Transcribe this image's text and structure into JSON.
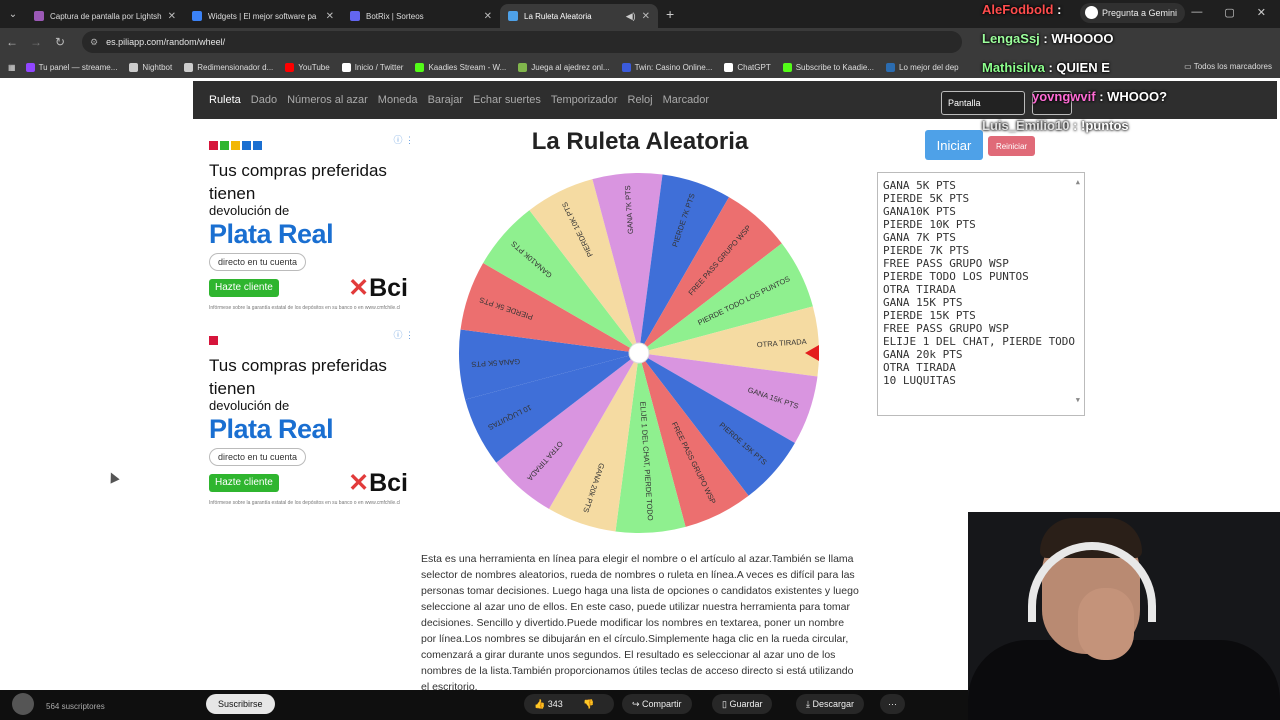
{
  "browser": {
    "tabs": [
      {
        "title": "Captura de pantalla por Lightsh",
        "color": "#9b59b6",
        "active": false
      },
      {
        "title": "Widgets | El mejor software pa",
        "color": "#3b82f6",
        "active": false
      },
      {
        "title": "BotRix | Sorteos",
        "color": "#6366f1",
        "active": false
      },
      {
        "title": "La Ruleta Aleatoria",
        "color": "#4ea1e8",
        "active": true
      }
    ],
    "url": "es.piliapp.com/random/wheel/",
    "bookmarks": [
      {
        "label": "Tu panel — streame...",
        "color": "#9146ff"
      },
      {
        "label": "Nightbot",
        "color": "#cccccc"
      },
      {
        "label": "Redimensionador d...",
        "color": "#cccccc"
      },
      {
        "label": "YouTube",
        "color": "#ff0000"
      },
      {
        "label": "Inicio / Twitter",
        "color": "#ffffff"
      },
      {
        "label": "Kaadies Stream - W...",
        "color": "#53fc18"
      },
      {
        "label": "Juega al ajedrez onl...",
        "color": "#81b64c"
      },
      {
        "label": "Twin: Casino Online...",
        "color": "#3b5bdb"
      },
      {
        "label": "ChatGPT",
        "color": "#ffffff"
      },
      {
        "label": "Subscribe to Kaadie...",
        "color": "#53fc18"
      },
      {
        "label": "Lo mejor del dep",
        "color": "#2b6cb0"
      }
    ],
    "bookmarks_right": "Todos los marcadores"
  },
  "site": {
    "nav": [
      "Ruleta",
      "Dado",
      "Números al azar",
      "Moneda",
      "Barajar",
      "Echar suertes",
      "Temporizador",
      "Reloj",
      "Marcador"
    ],
    "active_nav": "Ruleta",
    "fullscreen_label": "Pantalla",
    "title": "La Ruleta Aleatoria",
    "start_label": "Iniciar",
    "reset_label": "Reiniciar",
    "entries": [
      "GANA 5K PTS",
      "PIERDE 5K PTS",
      "GANA10K PTS",
      "PIERDE 10K PTS",
      "GANA 7K PTS",
      "PIERDE 7K PTS",
      "FREE PASS GRUPO WSP",
      "PIERDE TODO LOS PUNTOS",
      "OTRA TIRADA",
      "GANA 15K PTS",
      "PIERDE 15K PTS",
      "FREE PASS GRUPO WSP",
      "ELIJE 1 DEL CHAT, PIERDE TODO",
      "GANA 20k PTS",
      "OTRA TIRADA",
      "10 LUQUITAS"
    ],
    "description": "Esta es una herramienta en línea para elegir el nombre o el artículo al azar.También se llama selector de nombres aleatorios, rueda de nombres o ruleta en línea.A veces es difícil para las personas tomar decisiones. Luego haga una lista de opciones o candidatos existentes y luego seleccione al azar uno de ellos. En este caso, puede utilizar nuestra herramienta para tomar decisiones. Sencillo y divertido.Puede modificar los nombres en textarea, poner un nombre por línea.Los nombres se dibujarán en el círculo.Simplemente haga clic en la rueda circular, comenzará a girar durante unos segundos. El resultado es seleccionar al azar uno de los nombres de la lista.También proporcionamos útiles teclas de acceso directo si está utilizando el escritorio."
  },
  "wheel": {
    "labels": [
      "GANA 5K PTS",
      "PIERDE 5K PTS",
      "GANA10K PTS",
      "PIERDE 10K PTS",
      "GANA 7K PTS",
      "PIERDE 7K PTS",
      "FREE PASS GRUPO WSP",
      "PIERDE TODO LOS PUNTOS",
      "OTRA TIRADA",
      "GANA 15K PTS",
      "PIERDE 15K PTS",
      "FREE PASS GRUPO WSP",
      "ELIJE 1 DEL CHAT, PIERDE TODO",
      "GANA 20k PTS",
      "OTRA TIRADA",
      "10 LUQUITAS"
    ],
    "colors": [
      "#3f6fd8",
      "#ec6f6f",
      "#8ff08f",
      "#f5dba2",
      "#d995e0"
    ],
    "pointer_color": "#e41e1e",
    "rotation_deg": -105
  },
  "ads": [
    {
      "line1": "Tus compras preferidas tienen",
      "line2": "devolución de",
      "brand": "Plata Real",
      "pill": "directo en tu cuenta",
      "cta": "Hazte cliente",
      "bank": "Bci",
      "fine": "Infórmese sobre la garantía estatal de los depósitos en su banco o en www.cmfchile.cl"
    },
    {
      "line1": "Tus compras preferidas tienen",
      "line2": "devolución de",
      "brand": "Plata Real",
      "pill": "directo en tu cuenta",
      "cta": "Hazte cliente",
      "bank": "Bci",
      "fine": "Infórmese sobre la garantía estatal de los depósitos en su banco o en www.cmfchile.cl"
    }
  ],
  "youtube": {
    "subscribers": "564 suscriptores",
    "subscribe_label": "Suscribirse",
    "likes": "343",
    "share_label": "Compartir",
    "save_label": "Guardar",
    "download_label": "Descargar"
  },
  "overlay": {
    "gemini_label": "Pregunta a Gemini",
    "chat": [
      {
        "user": "AleFodbold",
        "message": "",
        "color": "#ff4d4d"
      },
      {
        "user": "LengaSsj",
        "message": "WHOOOO",
        "color": "#9cff9c"
      },
      {
        "user": "Mathisilva",
        "message": "QUIEN E",
        "color": "#8cff8c"
      },
      {
        "user": "yovngwvif",
        "message": "WHOOO?",
        "color": "#ff6bd5"
      },
      {
        "user": "Luis_Emilio10",
        "message": "!puntos",
        "color": "#e0e0e0"
      }
    ]
  }
}
